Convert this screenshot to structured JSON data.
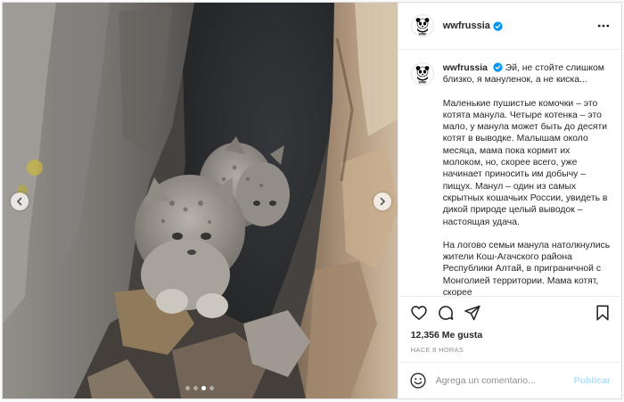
{
  "post": {
    "username": "wwfrussia",
    "account_logo_icon": "panda-logo-icon",
    "verified_icon": "verified-badge-icon",
    "more_icon": "more-options-icon",
    "image_alt": "Котята манула в расщелине скалы",
    "carousel": {
      "total": 4,
      "active_index": 2
    },
    "caption": {
      "username": "wwfrussia",
      "lead": "Эй, не стойте слишком близко, я мануленок, а не киска...",
      "paragraph_1": "Маленькие пушистые комочки – это котята манула. Четыре котенка – это мало, у манула может быть до десяти котят в выводке. Малышам около месяца, мама пока кормит их молоком, но, скорее всего, уже начинает приносить им добычу – пищух. Манул – один из самых скрытных кошачьих России, увидеть в дикой природе целый выводок – настоящая удача.",
      "paragraph_2": "На логово семьи манула натолкнулись жители Кош-Агачского района Республики Алтай, в приграничной с Монголией территории. Мама котят, скорее"
    },
    "likes_text": "12,356 Me gusta",
    "time_ago": "HACE 8 HORAS",
    "comment_placeholder": "Agrega un comentario...",
    "publish_label": "Publicar"
  },
  "colors": {
    "verified": "#0095f6",
    "publish_disabled": "#b2dffc",
    "muted": "#8e8e8e",
    "text": "#262626",
    "border": "#dbdbdb"
  }
}
